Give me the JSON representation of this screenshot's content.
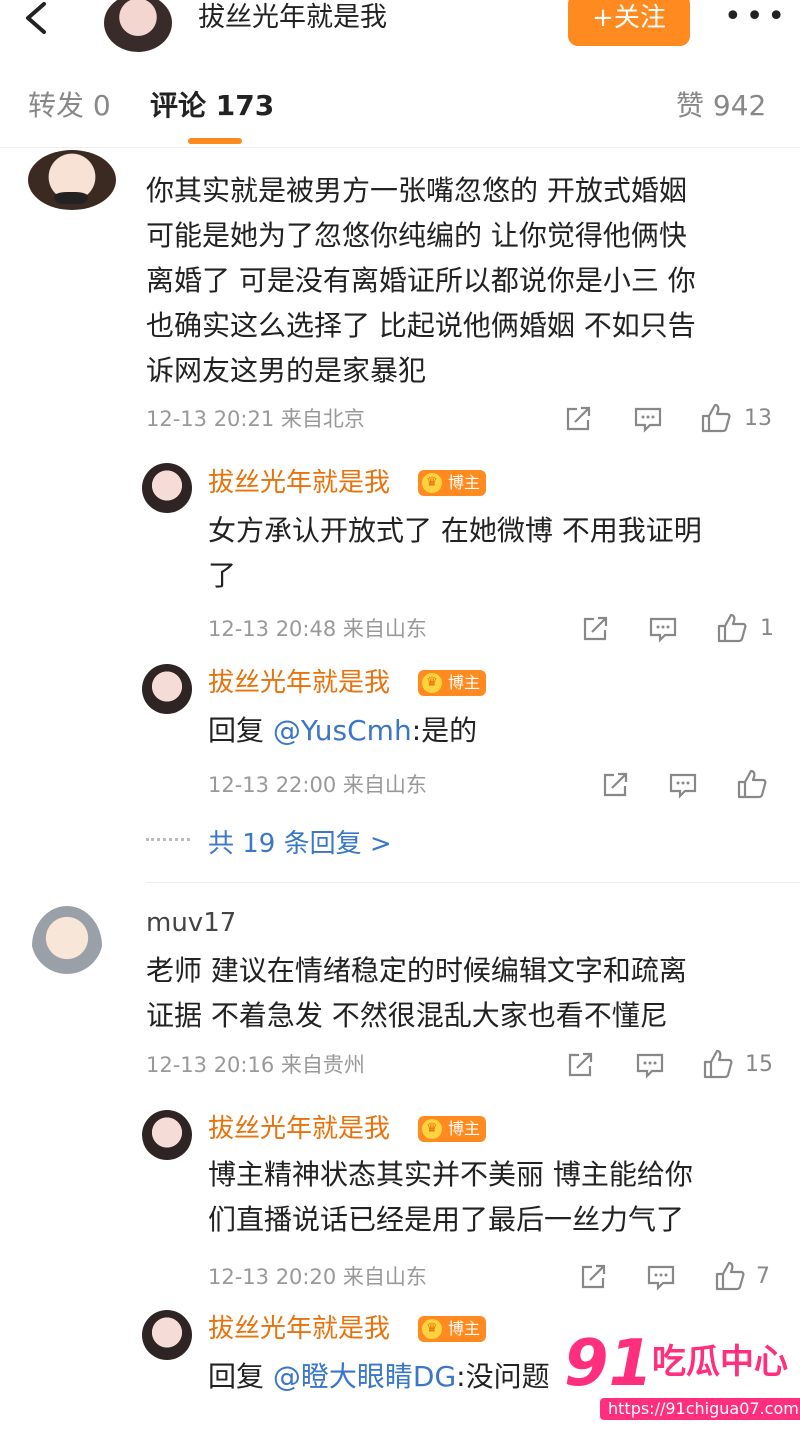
{
  "header": {
    "title": "拔丝光年就是我",
    "follow_label": "+关注",
    "more_label": "•••"
  },
  "tabs": {
    "repost": "转发 0",
    "comment": "评论 173",
    "like": "赞 942"
  },
  "comments": [
    {
      "text_lines": [
        "你其实就是被男方一张嘴忽悠的 开放式婚姻",
        "可能是她为了忽悠你纯编的 让你觉得他俩快",
        "离婚了 可是没有离婚证所以都说你是小三 你",
        "也确实这么选择了 比起说他俩婚姻 不如只告",
        "诉网友这男的是家暴犯"
      ],
      "meta": "12-13 20:21 来自北京",
      "likes": "13",
      "replies": [
        {
          "name": "拔丝光年就是我",
          "badge": "博主",
          "text_lines": [
            "女方承认开放式了 在她微博 不用我证明",
            "了"
          ],
          "meta": "12-13 20:48 来自山东",
          "likes": "1"
        },
        {
          "name": "拔丝光年就是我",
          "badge": "博主",
          "reply_prefix": "回复 ",
          "mention": "@YusCmh",
          "reply_text": ":是的",
          "meta": "12-13 22:00 来自山东",
          "likes": ""
        }
      ],
      "more_replies": "共 19 条回复 >"
    },
    {
      "name": "muv17",
      "text_lines": [
        "老师 建议在情绪稳定的时候编辑文字和疏离",
        "证据 不着急发 不然很混乱大家也看不懂尼"
      ],
      "meta": "12-13 20:16 来自贵州",
      "likes": "15",
      "replies": [
        {
          "name": "拔丝光年就是我",
          "badge": "博主",
          "text_lines": [
            "博主精神状态其实并不美丽 博主能给你",
            "们直播说话已经是用了最后一丝力气了"
          ],
          "meta": "12-13 20:20 来自山东",
          "likes": "7"
        },
        {
          "name": "拔丝光年就是我",
          "badge": "博主",
          "reply_prefix": "回复 ",
          "mention": "@瞪大眼睛DG",
          "reply_text": ":没问题"
        }
      ]
    }
  ],
  "icons": [
    "back-icon",
    "share-icon",
    "comment-icon",
    "like-icon",
    "crown-icon"
  ],
  "colors": {
    "accent": "#ff8a1f",
    "link": "#3a77c6",
    "watermark": "#ff2f7e"
  },
  "watermark": {
    "number": "91",
    "text": "吃瓜中心",
    "url": "https://91chigua07.com"
  }
}
